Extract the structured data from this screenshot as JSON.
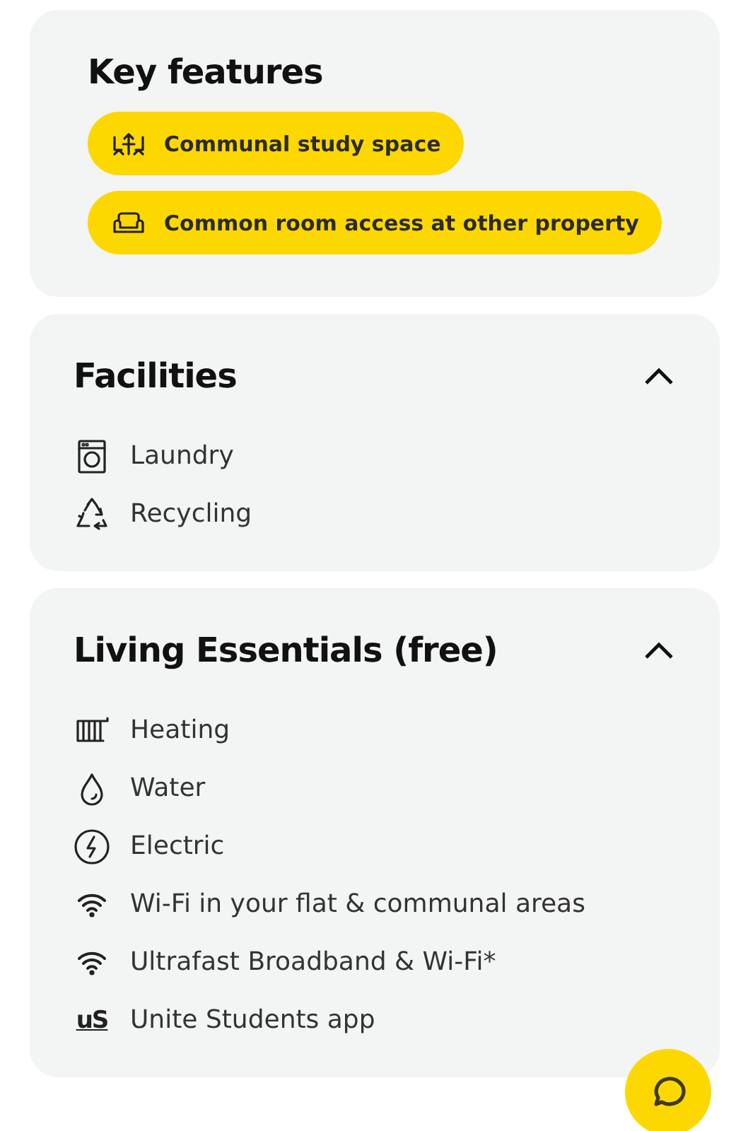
{
  "key_features": {
    "title": "Key features",
    "items": [
      {
        "kind": "study",
        "label": "Communal study space"
      },
      {
        "kind": "sofa",
        "label": "Common room access at other property"
      }
    ]
  },
  "sections": [
    {
      "title": "Facilities",
      "expanded": true,
      "items": [
        {
          "kind": "laundry",
          "label": "Laundry"
        },
        {
          "kind": "recycling",
          "label": "Recycling"
        }
      ]
    },
    {
      "title": "Living Essentials (free)",
      "expanded": true,
      "items": [
        {
          "kind": "heating",
          "label": "Heating"
        },
        {
          "kind": "water",
          "label": "Water"
        },
        {
          "kind": "electric",
          "label": "Electric"
        },
        {
          "kind": "wifi",
          "label": "Wi-Fi in your flat & communal areas"
        },
        {
          "kind": "wifi",
          "label": "Ultrafast Broadband & Wi-Fi*"
        },
        {
          "kind": "logo",
          "label": "Unite Students app",
          "icon_text": "uS"
        }
      ]
    }
  ]
}
